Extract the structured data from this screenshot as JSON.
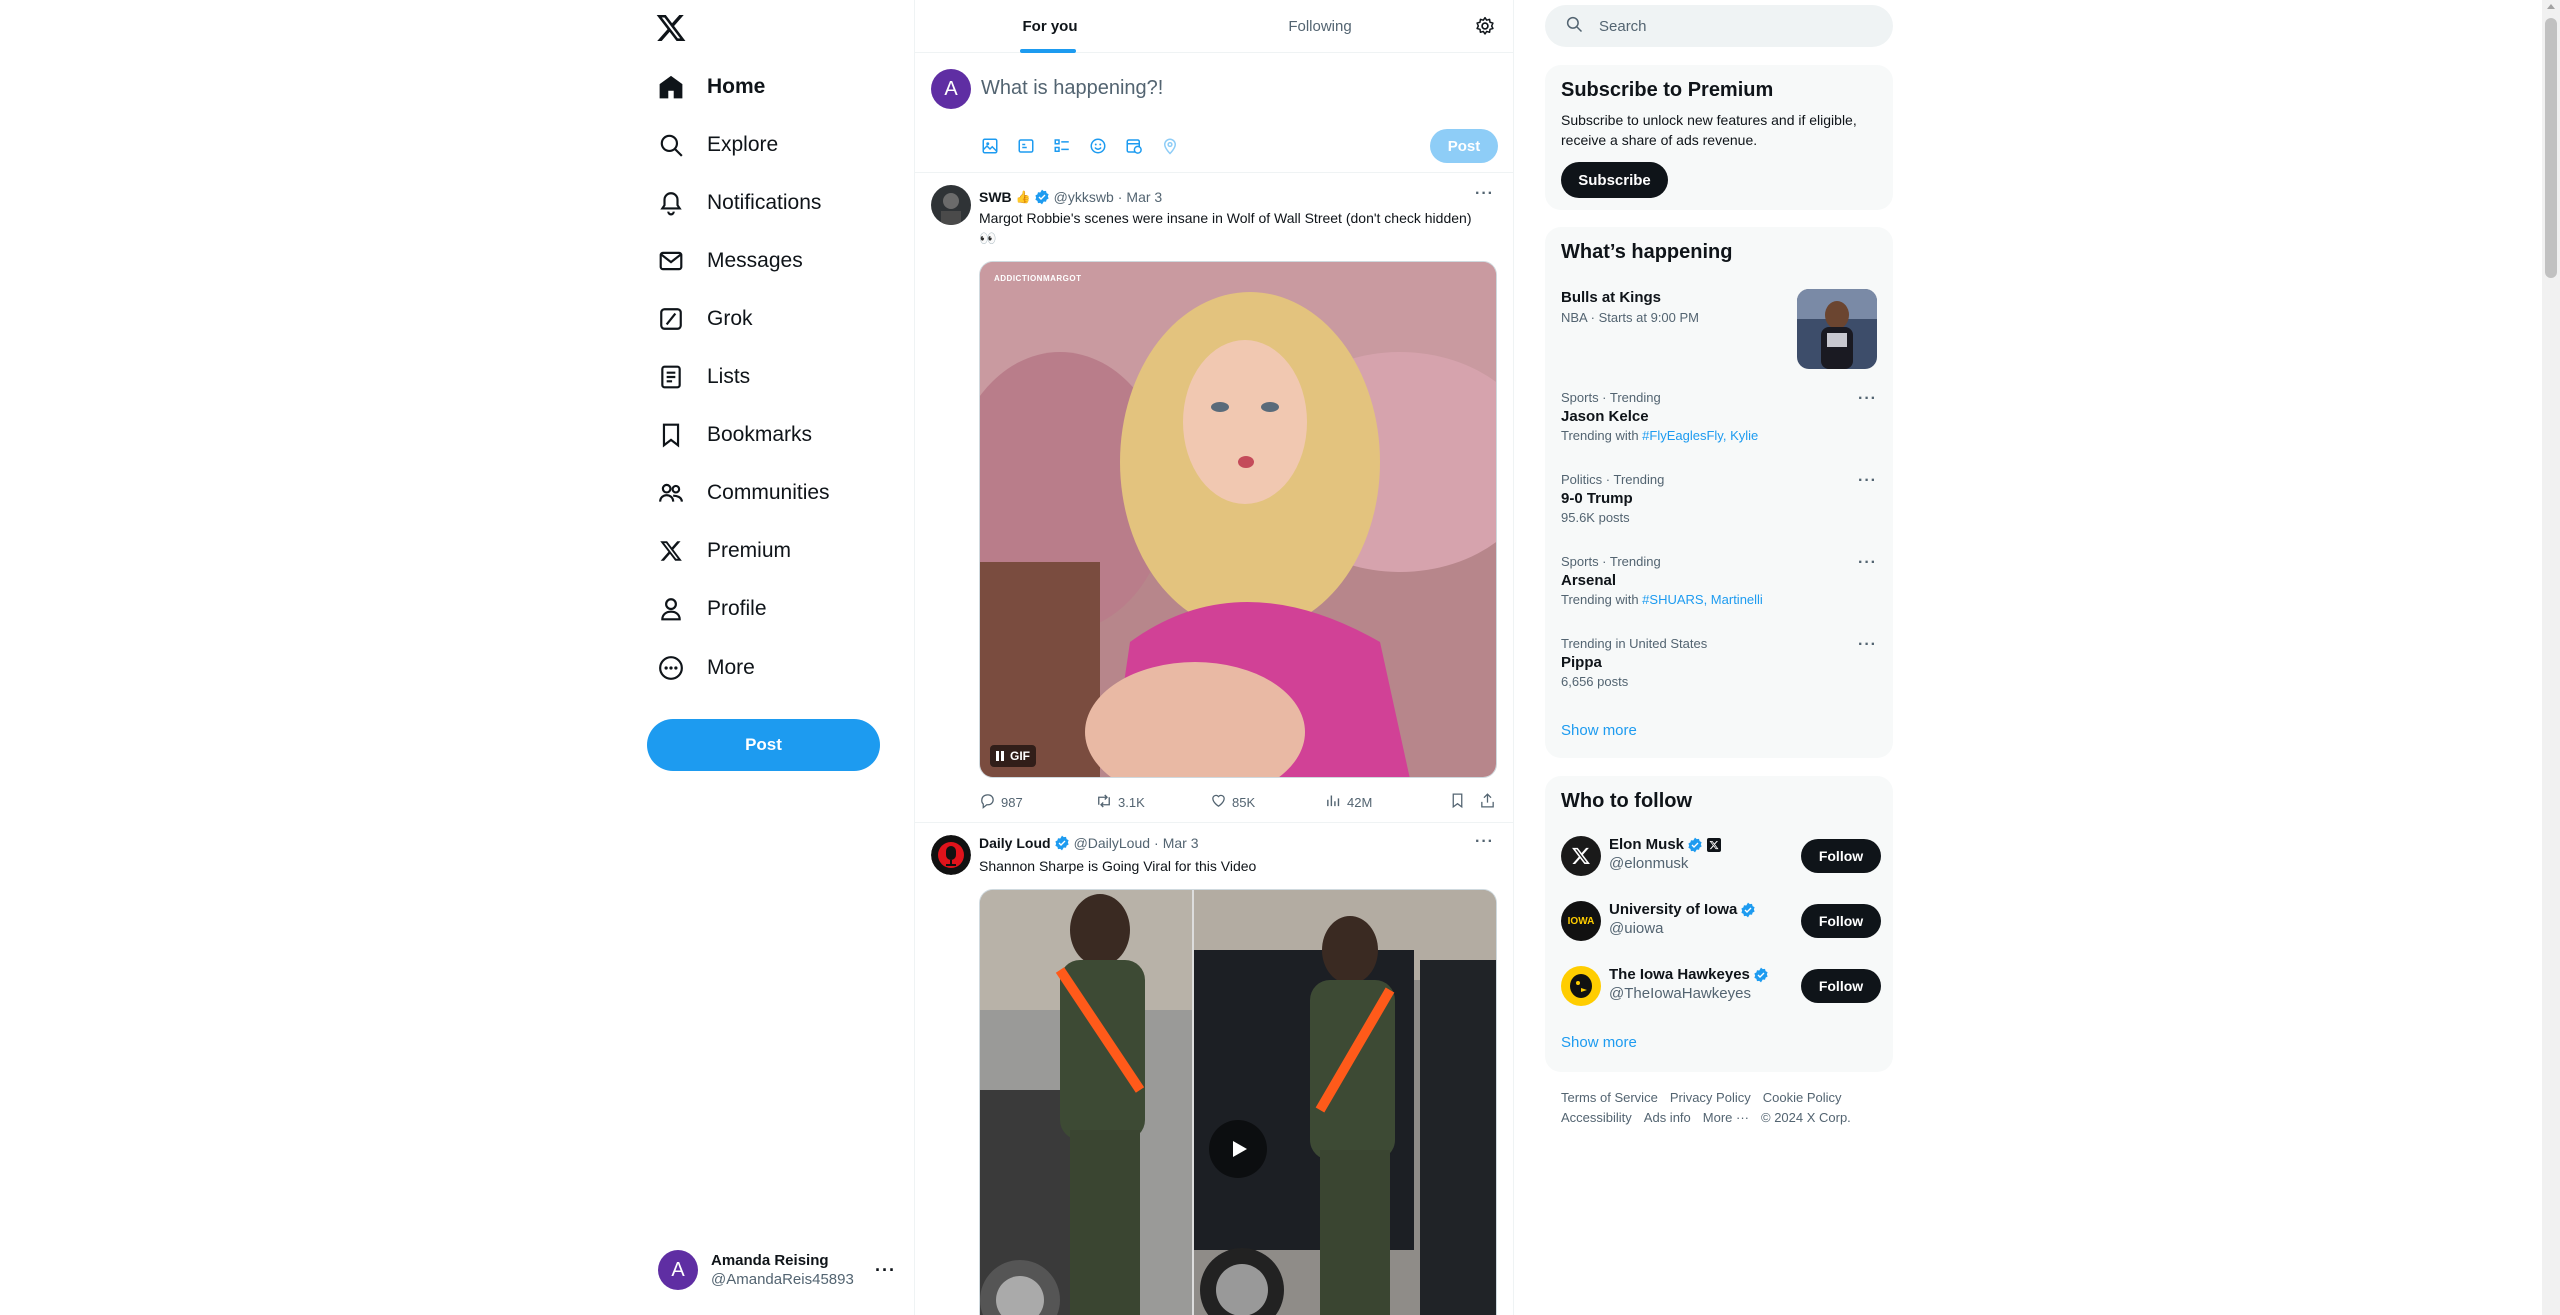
{
  "nav": {
    "items": [
      {
        "label": "Home",
        "icon": "home-icon",
        "active": true
      },
      {
        "label": "Explore",
        "icon": "search-icon"
      },
      {
        "label": "Notifications",
        "icon": "bell-icon"
      },
      {
        "label": "Messages",
        "icon": "envelope-icon"
      },
      {
        "label": "Grok",
        "icon": "grok-icon"
      },
      {
        "label": "Lists",
        "icon": "list-icon"
      },
      {
        "label": "Bookmarks",
        "icon": "bookmark-icon"
      },
      {
        "label": "Communities",
        "icon": "people-icon"
      },
      {
        "label": "Premium",
        "icon": "x-logo-icon"
      },
      {
        "label": "Profile",
        "icon": "person-icon"
      },
      {
        "label": "More",
        "icon": "more-circle-icon"
      }
    ],
    "post_label": "Post"
  },
  "account": {
    "initial": "A",
    "name": "Amanda Reising",
    "handle": "@AmandaReis45893",
    "more": "···"
  },
  "tabs": {
    "for_you": "For you",
    "following": "Following"
  },
  "composer": {
    "initial": "A",
    "placeholder": "What is happening?!",
    "post_label": "Post"
  },
  "tweets": [
    {
      "name": "SWB",
      "emoji": "👍",
      "handle": "@ykkswb",
      "date": "Mar 3",
      "text": "Margot Robbie's scenes were insane in Wolf of Wall Street (don't check hidden) 👀",
      "media_tag": "GIF",
      "media_watermark": "ADDICTIONMARGOT",
      "stats": {
        "replies": "987",
        "reposts": "3.1K",
        "likes": "85K",
        "views": "42M"
      }
    },
    {
      "name": "Daily Loud",
      "handle": "@DailyLoud",
      "date": "Mar 3",
      "text": "Shannon Sharpe is Going Viral for this Video"
    }
  ],
  "search": {
    "placeholder": "Search"
  },
  "premium": {
    "title": "Subscribe to Premium",
    "text": "Subscribe to unlock new features and if eligible, receive a share of ads revenue.",
    "button": "Subscribe"
  },
  "happening": {
    "title": "What’s happening",
    "event": {
      "title": "Bulls at Kings",
      "meta": "NBA · Starts at 9:00 PM"
    },
    "trends": [
      {
        "category": "Sports · Trending",
        "title": "Jason Kelce",
        "sub_prefix": "Trending with ",
        "sub_links": "#FlyEaglesFly, Kylie"
      },
      {
        "category": "Politics · Trending",
        "title": "9-0 Trump",
        "sub_prefix": "95.6K posts",
        "sub_links": ""
      },
      {
        "category": "Sports · Trending",
        "title": "Arsenal",
        "sub_prefix": "Trending with ",
        "sub_links": "#SHUARS, Martinelli"
      },
      {
        "category": "Trending in United States",
        "title": "Pippa",
        "sub_prefix": "6,656 posts",
        "sub_links": ""
      }
    ],
    "show_more": "Show more"
  },
  "who_to_follow": {
    "title": "Who to follow",
    "accounts": [
      {
        "name": "Elon Musk",
        "handle": "@elonmusk",
        "follow": "Follow"
      },
      {
        "name": "University of Iowa",
        "handle": "@uiowa",
        "follow": "Follow",
        "logo_text": "IOWA"
      },
      {
        "name": "The Iowa Hawkeyes",
        "handle": "@TheIowaHawkeyes",
        "follow": "Follow"
      }
    ],
    "show_more": "Show more"
  },
  "footer": {
    "links": [
      "Terms of Service",
      "Privacy Policy",
      "Cookie Policy",
      "Accessibility",
      "Ads info",
      "More ···"
    ],
    "copyright": "© 2024 X Corp."
  },
  "colors": {
    "accent": "#1d9bf0",
    "text": "#0f1419",
    "muted": "#536471",
    "avatar": "#5f2ea3"
  }
}
